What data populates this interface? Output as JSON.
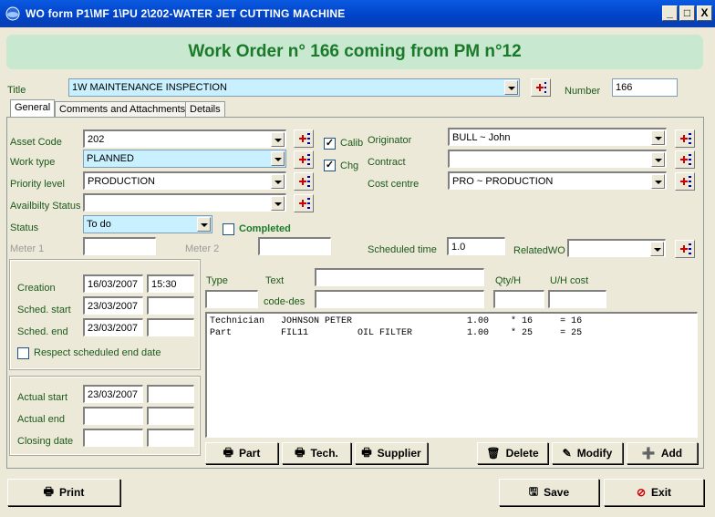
{
  "window": {
    "title": "WO form P1\\MF 1\\PU 2\\202-WATER JET CUTTING MACHINE",
    "minimize": "_",
    "maximize": "□",
    "close": "X"
  },
  "banner": "Work Order n° 166 coming from PM n°12",
  "header": {
    "title_label": "Title",
    "title_value": "1W MAINTENANCE INSPECTION",
    "number_label": "Number",
    "number_value": "166"
  },
  "tabs": [
    "General",
    "Comments and Attachments",
    "Details"
  ],
  "general": {
    "asset_code_label": "Asset Code",
    "asset_code": "202",
    "work_type_label": "Work type",
    "work_type": "PLANNED",
    "priority_label": "Priority level",
    "priority": "PRODUCTION",
    "availability_label": "Availbilty Status",
    "availability": "",
    "status_label": "Status",
    "status": "To do",
    "completed_label": "Completed",
    "calib_label": "Calib",
    "chg_label": "Chg",
    "originator_label": "Originator",
    "originator": "BULL ~ John",
    "contract_label": "Contract",
    "contract": "",
    "cost_centre_label": "Cost centre",
    "cost_centre": "PRO ~ PRODUCTION",
    "meter1_label": "Meter 1",
    "meter2_label": "Meter 2",
    "scheduled_time_label": "Scheduled time",
    "scheduled_time": "1.0",
    "related_wo_label": "RelatedWO",
    "related_wo": ""
  },
  "dates": {
    "creation_label": "Creation",
    "creation_date": "16/03/2007",
    "creation_time": "15:30",
    "sched_start_label": "Sched. start",
    "sched_start_date": "23/03/2007",
    "sched_end_label": "Sched. end",
    "sched_end_date": "23/03/2007",
    "respect_label": "Respect scheduled end date",
    "actual_start_label": "Actual start",
    "actual_start_date": "23/03/2007",
    "actual_end_label": "Actual end",
    "closing_label": "Closing date"
  },
  "details": {
    "type_label": "Type",
    "text_label": "Text",
    "qty_label": "Qty/H",
    "uh_cost_label": "U/H cost",
    "code_des_label": "code-des",
    "lines": [
      "Technician   JOHNSON PETER                     1.00    * 16     = 16",
      "Part         FIL11         OIL FILTER          1.00    * 25     = 25"
    ]
  },
  "buttons": {
    "part": "Part",
    "tech": "Tech.",
    "supplier": "Supplier",
    "delete": "Delete",
    "modify": "Modify",
    "add": "Add",
    "print": "Print",
    "save": "Save",
    "exit": "Exit"
  },
  "colors": {
    "title_bar": "#0a5ae0",
    "banner_bg": "#c8e8d0",
    "banner_text": "#1a7a2a",
    "label_green": "#1a5a1a",
    "highlight_cyan": "#c8f0ff"
  }
}
